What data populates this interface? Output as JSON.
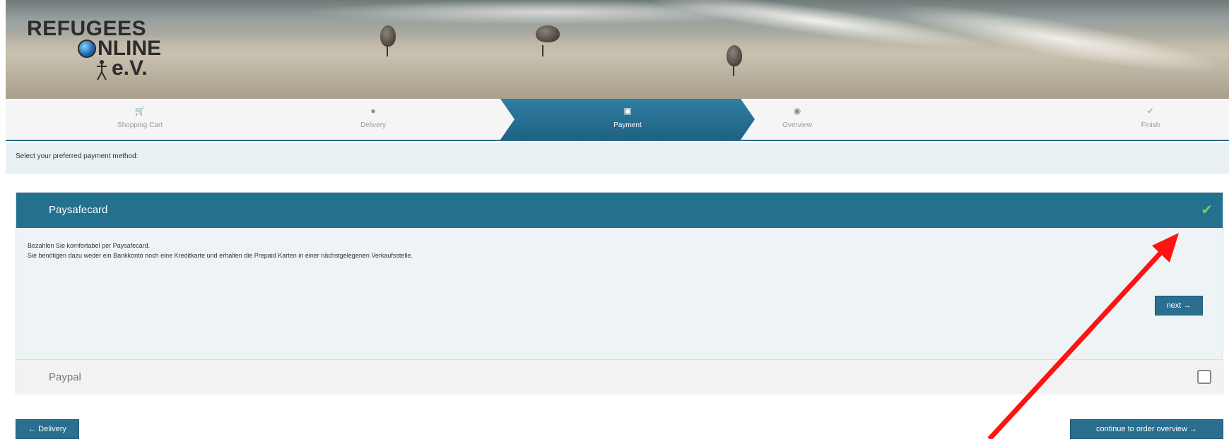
{
  "header": {
    "logo_line1": "REFUGEES",
    "logo_line2": "NLINE",
    "logo_line3": "e.V."
  },
  "steps": [
    {
      "label": "Shopping Cart",
      "icon": "cart-icon",
      "active": false
    },
    {
      "label": "Delivery",
      "icon": "map-marker-icon",
      "active": false
    },
    {
      "label": "Payment",
      "icon": "money-icon",
      "active": true
    },
    {
      "label": "Overview",
      "icon": "eye-icon",
      "active": false
    },
    {
      "label": "Finish",
      "icon": "check-icon",
      "active": false
    }
  ],
  "info": {
    "text": "Select your preferred payment method:"
  },
  "payment_methods": {
    "paysafecard": {
      "title": "Paysafecard",
      "selected": true,
      "description_line1": "Bezahlen Sie komfortabel per Paysafecard.",
      "description_line2": "Sie benötigen dazu weder ein Bankkonto noch eine Kreditkarte und erhalten die Prepaid Karten in einer nächstgelegenen Verkaufsstelle.",
      "next_label": "next →"
    },
    "paypal": {
      "title": "Paypal",
      "selected": false
    }
  },
  "footer": {
    "back_label": "← Delivery",
    "continue_label": "continue to order overview →"
  },
  "colors": {
    "accent": "#23708f",
    "check": "#6fd066",
    "annotation_arrow": "#ff1212"
  }
}
